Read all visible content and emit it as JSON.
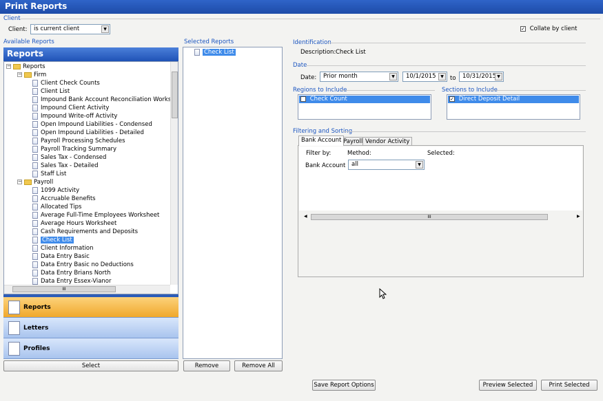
{
  "window": {
    "title": "Print Reports"
  },
  "client_section": {
    "group_label": "Client",
    "client_label": "Client:",
    "client_value": "is current client",
    "collate_label": "Collate by client",
    "collate_checked": true
  },
  "available_reports": {
    "group_label": "Available Reports",
    "header": "Reports",
    "tree": {
      "root": "Reports",
      "firm": {
        "label": "Firm",
        "items": [
          "Client Check Counts",
          "Client List",
          "Impound Bank Account Reconciliation Workshe",
          "Impound Client Activity",
          "Impound Write-off Activity",
          "Open Impound Liabilities - Condensed",
          "Open Impound Liabilities - Detailed",
          "Payroll Processing Schedules",
          "Payroll Tracking Summary",
          "Sales Tax - Condensed",
          "Sales Tax - Detailed",
          "Staff List"
        ]
      },
      "payroll": {
        "label": "Payroll",
        "items": [
          "1099 Activity",
          "Accruable Benefits",
          "Allocated Tips",
          "Average Full-Time Employees Worksheet",
          "Average Hours Worksheet",
          "Cash Requirements and Deposits",
          "Check List",
          "Client Information",
          "Data Entry Basic",
          "Data Entry Basic no Deductions",
          "Data Entry Brians North",
          "Data Entry Essex-Vianor"
        ]
      },
      "selected_item": "Check List"
    },
    "nav": [
      {
        "label": "Reports",
        "icon": "report-icon",
        "active": true
      },
      {
        "label": "Letters",
        "icon": "letter-icon",
        "active": false
      },
      {
        "label": "Profiles",
        "icon": "profile-icon",
        "active": false
      }
    ],
    "select_button": "Select",
    "hscroll_grip": "III"
  },
  "selected_reports": {
    "group_label": "Selected Reports",
    "items": [
      "Check List"
    ],
    "remove_button": "Remove",
    "remove_all_button": "Remove All"
  },
  "identification": {
    "group_label": "Identification",
    "description_label": "Description:",
    "description_value": "Check List"
  },
  "date": {
    "group_label": "Date",
    "date_label": "Date:",
    "period_value": "Prior month",
    "from_value": "10/1/2015",
    "to_label": "to",
    "to_value": "10/31/2015"
  },
  "regions": {
    "group_label": "Regions to Include",
    "items": [
      {
        "label": "Check Count",
        "checked": false
      }
    ]
  },
  "sections": {
    "group_label": "Sections to Include",
    "items": [
      {
        "label": "Direct Deposit Detail",
        "checked": true
      }
    ]
  },
  "filtering": {
    "group_label": "Filtering and Sorting",
    "tabs": [
      "Bank Account",
      "Payroll",
      "Vendor Activity"
    ],
    "active_tab": "Bank Account",
    "columns": {
      "filter_by": "Filter by:",
      "method": "Method:",
      "selected": "Selected:"
    },
    "row": {
      "label": "Bank Account",
      "method": "all"
    },
    "hscroll_grip": "III"
  },
  "footer": {
    "save_options": "Save Report Options",
    "preview_selected": "Preview Selected",
    "print_selected": "Print Selected"
  },
  "colors": {
    "title_bar": "#1d4ba8",
    "selection": "#3f8bea",
    "active_nav": "#f5b53a",
    "group_label": "#1b55c0"
  }
}
